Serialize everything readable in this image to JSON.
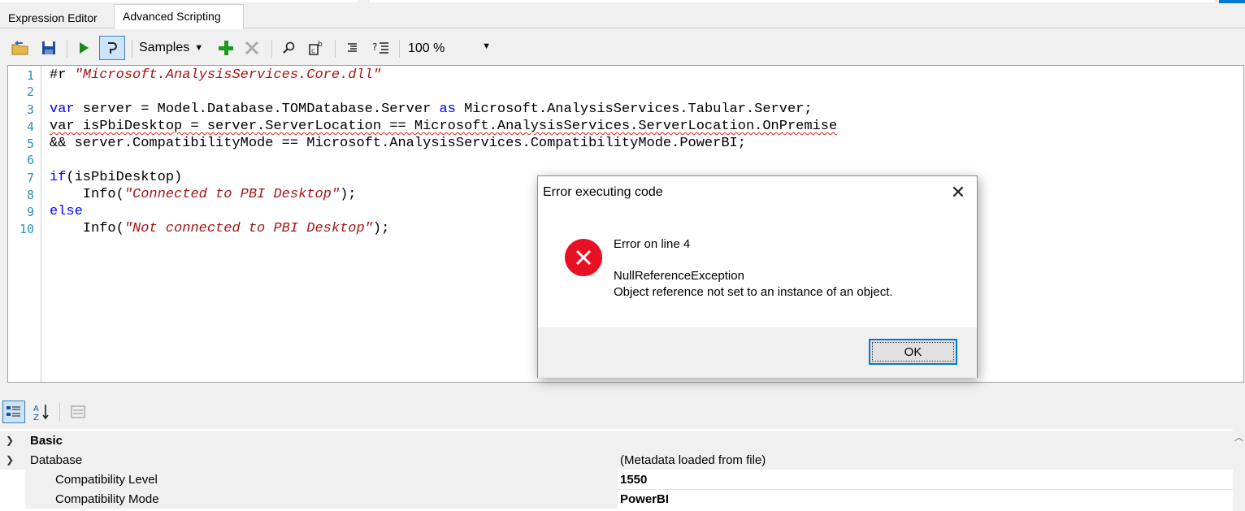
{
  "tabs": [
    {
      "label": "Expression Editor"
    },
    {
      "label": "Advanced Scripting"
    }
  ],
  "toolbar": {
    "samples_label": "Samples",
    "zoom_value": "100 %"
  },
  "editor": {
    "line_numbers": [
      "1",
      "2",
      "3",
      "4",
      "5",
      "6",
      "7",
      "8",
      "9",
      "10"
    ],
    "lines": [
      {
        "parts": [
          {
            "t": "#r ",
            "c": "plain"
          },
          {
            "t": "\"Microsoft.AnalysisServices.Core.dll\"",
            "c": "str"
          }
        ]
      },
      {
        "parts": []
      },
      {
        "parts": [
          {
            "t": "var",
            "c": "kw"
          },
          {
            "t": " server = Model.Database.TOMDatabase.Server ",
            "c": "plain"
          },
          {
            "t": "as",
            "c": "kw"
          },
          {
            "t": " Microsoft.AnalysisServices.Tabular.Server;",
            "c": "plain"
          }
        ]
      },
      {
        "parts": [
          {
            "t": "var isPbiDesktop = server.ServerLocation == Microsoft.AnalysisServices.ServerLocation.OnPremise",
            "c": "squig"
          }
        ]
      },
      {
        "parts": [
          {
            "t": "&& server.CompatibilityMode == Microsoft.AnalysisServices.CompatibilityMode.PowerBI;",
            "c": "plain"
          }
        ]
      },
      {
        "parts": []
      },
      {
        "parts": [
          {
            "t": "if",
            "c": "kw"
          },
          {
            "t": "(isPbiDesktop)",
            "c": "plain"
          }
        ]
      },
      {
        "parts": [
          {
            "t": "    Info(",
            "c": "plain"
          },
          {
            "t": "\"Connected to PBI Desktop\"",
            "c": "str"
          },
          {
            "t": ");",
            "c": "plain"
          }
        ]
      },
      {
        "parts": [
          {
            "t": "else",
            "c": "kw"
          }
        ]
      },
      {
        "parts": [
          {
            "t": "    Info(",
            "c": "plain"
          },
          {
            "t": "\"Not connected to PBI Desktop\"",
            "c": "str"
          },
          {
            "t": ");",
            "c": "plain"
          }
        ]
      }
    ]
  },
  "dialog": {
    "title": "Error executing code",
    "line1": "Error on line 4",
    "line2": "NullReferenceException",
    "line3": "Object reference not set to an instance of an object.",
    "ok_label": "OK"
  },
  "properties": {
    "category": "Basic",
    "group_label": "Database",
    "group_value": "(Metadata loaded from file)",
    "rows": [
      {
        "label": "Compatibility Level",
        "value": "1550"
      },
      {
        "label": "Compatibility Mode",
        "value": "PowerBI"
      }
    ]
  },
  "colors": {
    "keyword": "#0000ff",
    "string": "#a31515",
    "line_number": "#2b91af",
    "error_icon": "#e81123",
    "accent": "#0078d7"
  }
}
